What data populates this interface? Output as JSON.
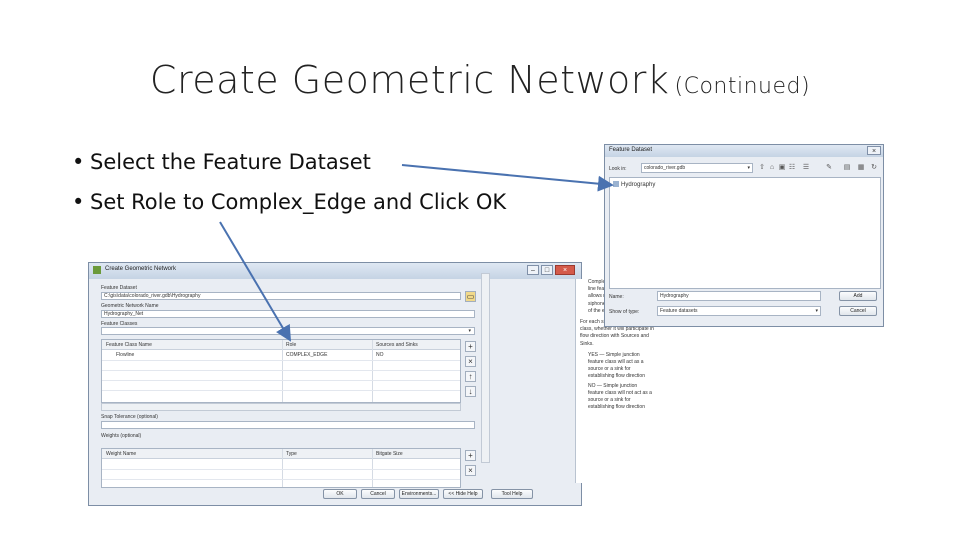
{
  "slide": {
    "title": "Create Geometric Network",
    "title_suffix": "(Continued)",
    "bullets": [
      "Select the Feature Dataset",
      "Set Role to Complex_Edge and Click OK"
    ]
  },
  "create_dialog": {
    "title": "Create Geometric Network",
    "feature_dataset_label": "Feature Dataset",
    "feature_dataset_value": "C:\\gis\\data\\colorado_river.gdb\\Hydrography",
    "network_name_label": "Geometric Network Name",
    "network_name_value": "Hydrography_Net",
    "feature_classes_label": "Feature Classes",
    "feature_table": {
      "columns": [
        "Feature Class Name",
        "Role",
        "Sources and Sinks"
      ],
      "rows": [
        [
          "Flowline",
          "COMPLEX_EDGE",
          "NO"
        ]
      ]
    },
    "snap_label": "Snap Tolerance (optional)",
    "weights_label": "Weights (optional)",
    "weight_table": {
      "columns": [
        "Weight Name",
        "Type",
        "Bitgate Size"
      ]
    },
    "help_text_top": "Complex_Edge — Used for line feature classes and allows resources to be siphoned off along the length of the edge.",
    "help_text_mid": "For each simple junction feature class, whether it will participate in flow direction with Sources and Sinks.",
    "help_bullets": [
      "YES — Simple junction feature class will act as a source or a sink for establishing flow direction",
      "NO — Simple junction feature class will not act as a source or a sink for establishing flow direction"
    ],
    "buttons": [
      "OK",
      "Cancel",
      "Environments...",
      "<< Hide Help",
      "Tool Help"
    ]
  },
  "dataset_dialog": {
    "title": "Feature Dataset",
    "look_in_label": "Look in:",
    "look_in_value": "colorado_river.gdb",
    "list_items": [
      "Hydrography"
    ],
    "name_label": "Name:",
    "name_value": "Hydrography",
    "show_type_label": "Show of type:",
    "show_type_value": "Feature datasets",
    "add_button": "Add",
    "cancel_button": "Cancel"
  }
}
